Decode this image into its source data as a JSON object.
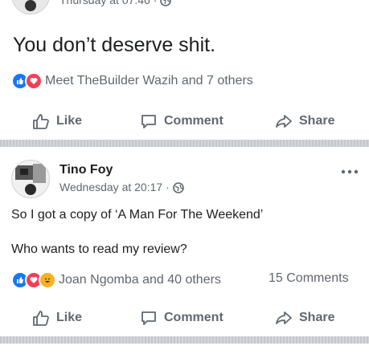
{
  "post1": {
    "timestamp": "Thursday at 07:46",
    "body": "You don’t deserve shit.",
    "reactions_text": "Meet TheBuilder Wazih and 7 others",
    "reaction_icons": [
      "like-icon",
      "love-icon"
    ]
  },
  "post2": {
    "author": "Tino Foy",
    "timestamp": "Wednesday at 20:17",
    "body_line1": "So I got a copy of ‘A Man For The Weekend’",
    "body_line2": "Who wants to read my review?",
    "reactions_text": "Joan Ngomba and 40 others",
    "comments_count": "15 Comments",
    "reaction_icons": [
      "like-icon",
      "love-icon",
      "haha-icon"
    ]
  },
  "actions": {
    "like": "Like",
    "comment": "Comment",
    "share": "Share"
  },
  "separator": "·",
  "colors": {
    "like_blue": "#1877f2",
    "love_red": "#f33e58",
    "haha_yellow": "#f7b125",
    "divider": "#c9ccd1",
    "meta_gray": "#606770"
  }
}
